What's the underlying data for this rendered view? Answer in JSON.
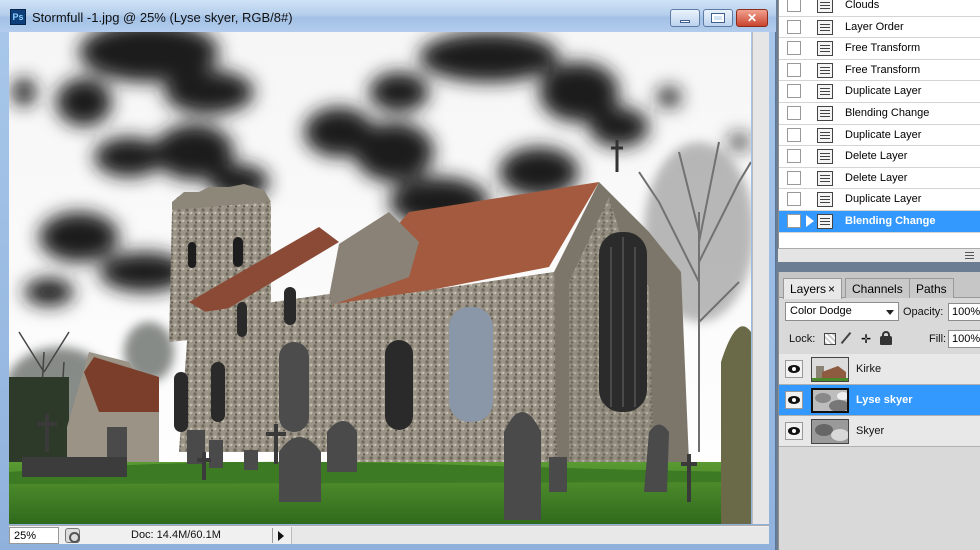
{
  "window": {
    "title": "Stormfull -1.jpg @ 25% (Lyse skyer, RGB/8#)",
    "app_icon_text": "Ps"
  },
  "status": {
    "zoom": "25%",
    "doc_info": "Doc: 14.4M/60.1M"
  },
  "history": {
    "items": [
      {
        "label": "Clouds"
      },
      {
        "label": "Layer Order"
      },
      {
        "label": "Free Transform"
      },
      {
        "label": "Free Transform"
      },
      {
        "label": "Duplicate Layer"
      },
      {
        "label": "Blending Change"
      },
      {
        "label": "Duplicate Layer"
      },
      {
        "label": "Delete Layer"
      },
      {
        "label": "Delete Layer"
      },
      {
        "label": "Duplicate Layer"
      },
      {
        "label": "Blending Change"
      }
    ],
    "selected_index": 10
  },
  "layers_panel": {
    "tabs": [
      {
        "label": "Layers",
        "close": "×"
      },
      {
        "label": "Channels"
      },
      {
        "label": "Paths"
      }
    ],
    "blend_mode": "Color Dodge",
    "opacity_label": "Opacity:",
    "opacity_value": "100%",
    "lock_label": "Lock:",
    "fill_label": "Fill:",
    "fill_value": "100%",
    "layers": [
      {
        "name": "Kirke"
      },
      {
        "name": "Lyse skyer"
      },
      {
        "name": "Skyer"
      }
    ],
    "selected_layer_index": 1
  },
  "colors": {
    "selection": "#3399ff",
    "title_bar": "#b6cfec",
    "close_button": "#c9452e"
  }
}
